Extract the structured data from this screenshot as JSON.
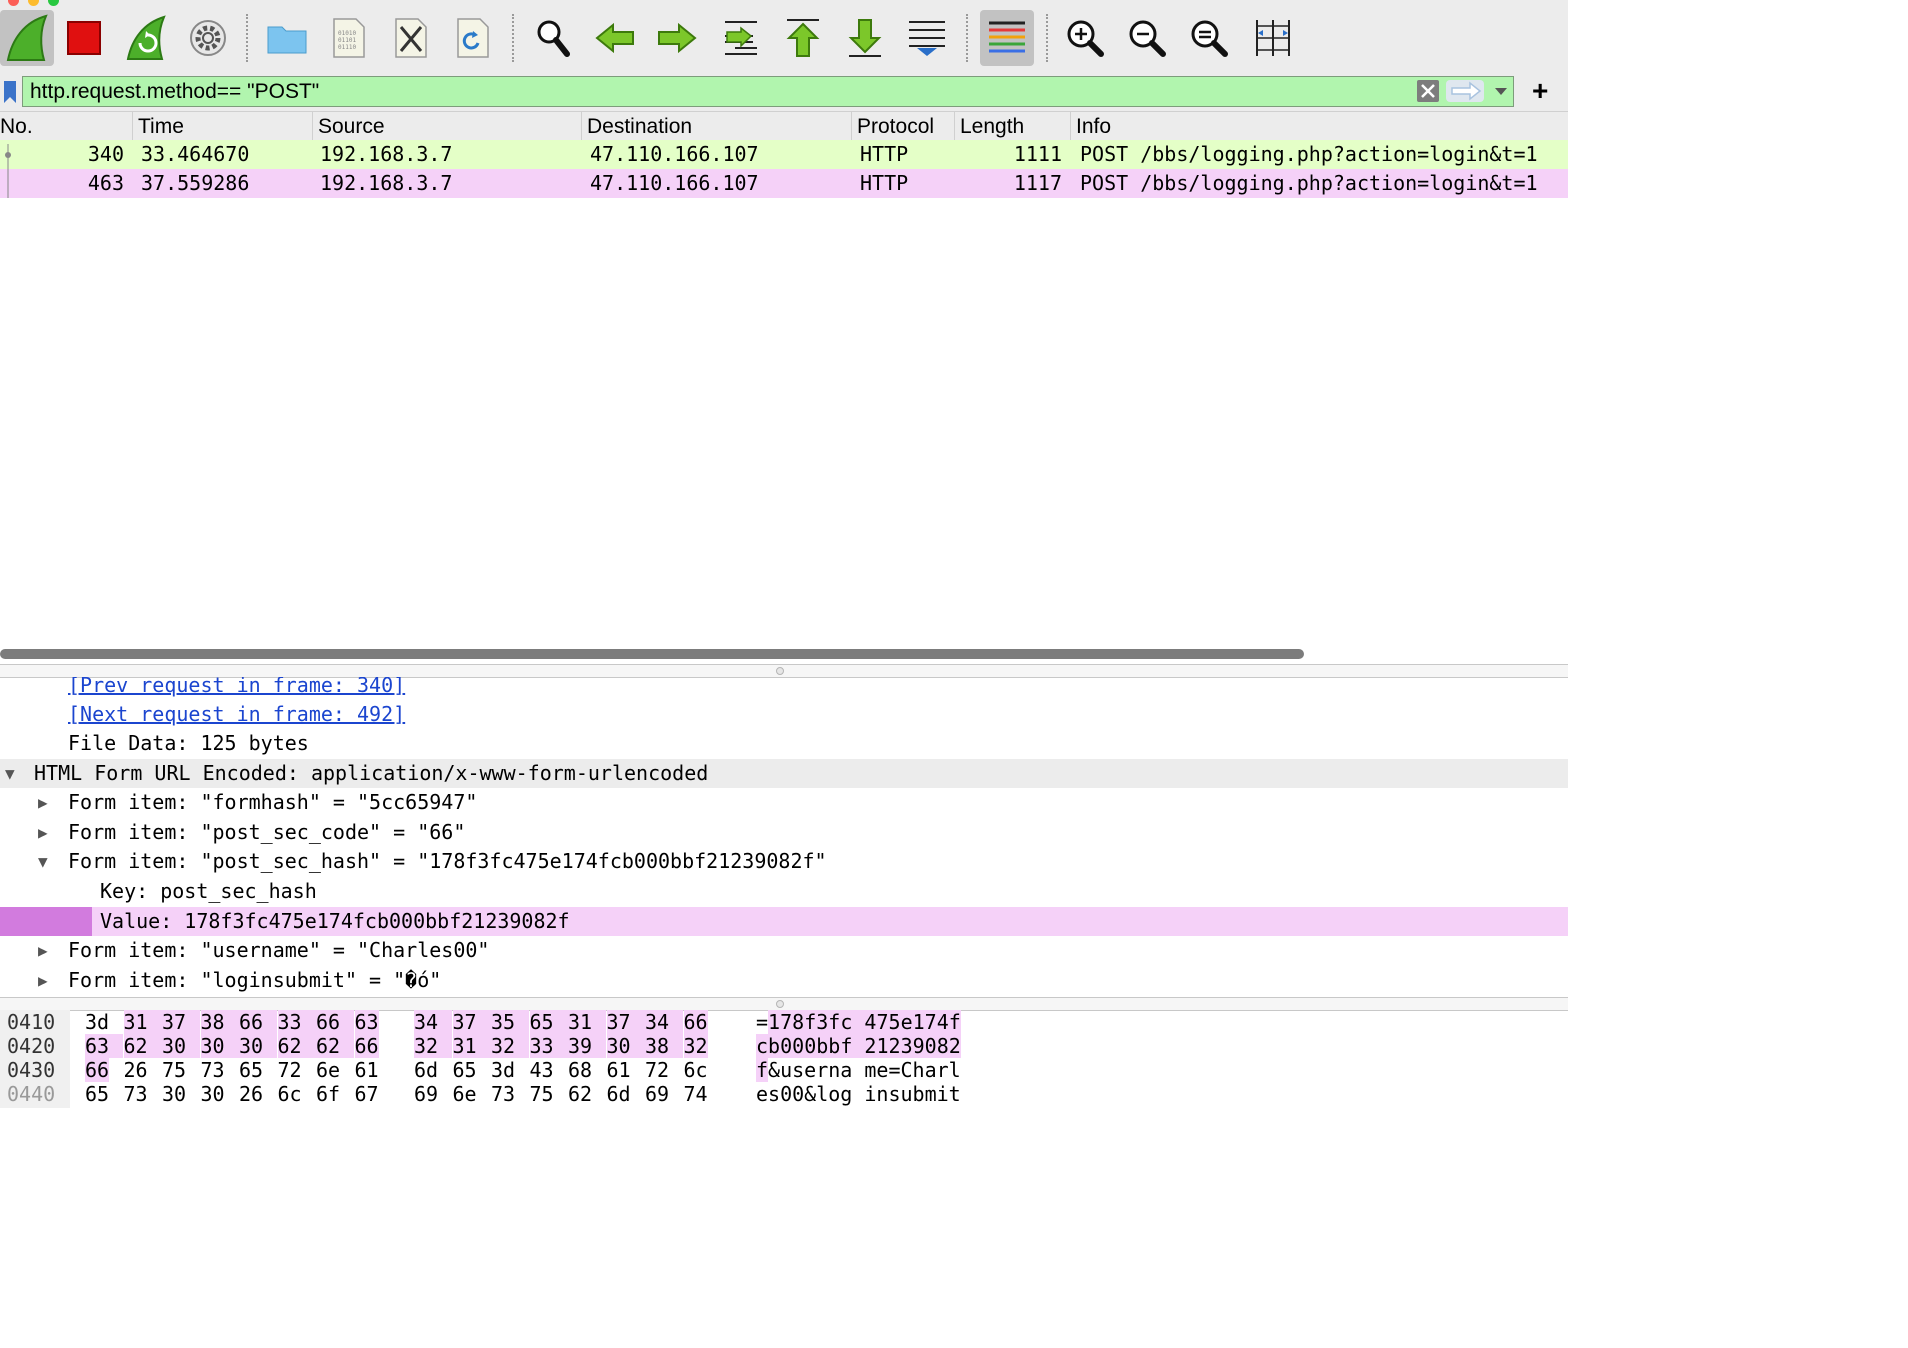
{
  "toolbar": {
    "buttons": [
      {
        "name": "start-capture",
        "icon": "shark-fin-icon"
      },
      {
        "name": "stop-capture",
        "icon": "stop-icon"
      },
      {
        "name": "restart-capture",
        "icon": "restart-fin-icon"
      },
      {
        "name": "capture-options",
        "icon": "gear-icon"
      },
      {
        "name": "open-file",
        "icon": "folder-icon"
      },
      {
        "name": "save-file",
        "icon": "binary-file-icon"
      },
      {
        "name": "close-file",
        "icon": "close-file-icon"
      },
      {
        "name": "reload-file",
        "icon": "reload-file-icon"
      },
      {
        "name": "find-packet",
        "icon": "search-icon"
      },
      {
        "name": "go-back",
        "icon": "arrow-left-icon"
      },
      {
        "name": "go-forward",
        "icon": "arrow-right-icon"
      },
      {
        "name": "go-to-packet",
        "icon": "goto-packet-icon"
      },
      {
        "name": "go-first",
        "icon": "arrow-top-icon"
      },
      {
        "name": "go-last",
        "icon": "arrow-bottom-icon"
      },
      {
        "name": "autoscroll",
        "icon": "autoscroll-icon"
      },
      {
        "name": "colorize",
        "icon": "colorize-icon"
      },
      {
        "name": "zoom-in",
        "icon": "zoom-in-icon"
      },
      {
        "name": "zoom-out",
        "icon": "zoom-out-icon"
      },
      {
        "name": "normal-size",
        "icon": "zoom-reset-icon"
      },
      {
        "name": "resize-columns",
        "icon": "resize-columns-icon"
      }
    ]
  },
  "filter": {
    "value": "http.request.method== \"POST\"",
    "bg_color": "#b1f5ae"
  },
  "packet_list": {
    "columns": [
      "No.",
      "Time",
      "Source",
      "Destination",
      "Protocol",
      "Length",
      "Info"
    ],
    "rows": [
      {
        "no": "340",
        "time": "33.464670",
        "source": "192.168.3.7",
        "destination": "47.110.166.107",
        "protocol": "HTTP",
        "length": "1111",
        "info": "POST /bbs/logging.php?action=login&t=1",
        "color": "#e4ffc7"
      },
      {
        "no": "463",
        "time": "37.559286",
        "source": "192.168.3.7",
        "destination": "47.110.166.107",
        "protocol": "HTTP",
        "length": "1117",
        "info": "POST /bbs/logging.php?action=login&t=1",
        "color": "#f5d1f8"
      }
    ]
  },
  "details": {
    "prev_request": "[Prev request in frame: 340]",
    "next_request": "[Next request in frame: 492]",
    "file_data": "File Data: 125 bytes",
    "form_header": "HTML Form URL Encoded: application/x-www-form-urlencoded",
    "items": [
      "Form item: \"formhash\" = \"5cc65947\"",
      "Form item: \"post_sec_code\" = \"66\"",
      "Form item: \"post_sec_hash\" = \"178f3fc475e174fcb000bbf21239082f\""
    ],
    "key": "Key: post_sec_hash",
    "value": "Value: 178f3fc475e174fcb000bbf21239082f",
    "items_after": [
      "Form item: \"username\" = \"Charles00\"",
      "Form item: \"loginsubmit\" = \"�ó\""
    ]
  },
  "bytes": {
    "rows": [
      {
        "offset": "0410",
        "hex1": [
          "3d",
          "31",
          "37",
          "38",
          "66",
          "33",
          "66",
          "63"
        ],
        "hex2": [
          "34",
          "37",
          "35",
          "65",
          "31",
          "37",
          "34",
          "66"
        ],
        "ascii1": "=178f3fc",
        "ascii2": "475e174f",
        "hl_start": 1
      },
      {
        "offset": "0420",
        "hex1": [
          "63",
          "62",
          "30",
          "30",
          "30",
          "62",
          "62",
          "66"
        ],
        "hex2": [
          "32",
          "31",
          "32",
          "33",
          "39",
          "30",
          "38",
          "32"
        ],
        "ascii1": "cb000bbf",
        "ascii2": "21239082",
        "hl_start": 0
      },
      {
        "offset": "0430",
        "hex1": [
          "66",
          "26",
          "75",
          "73",
          "65",
          "72",
          "6e",
          "61"
        ],
        "hex2": [
          "6d",
          "65",
          "3d",
          "43",
          "68",
          "61",
          "72",
          "6c"
        ],
        "ascii1": "f&userna",
        "ascii2": "me=Charl",
        "hl_end": 1
      },
      {
        "offset": "0440",
        "hex1": [
          "65",
          "73",
          "30",
          "30",
          "26",
          "6c",
          "6f",
          "67"
        ],
        "hex2": [
          "69",
          "6e",
          "73",
          "75",
          "62",
          "6d",
          "69",
          "74"
        ],
        "ascii1": "es00&log",
        "ascii2": "insubmit",
        "hl_end": 0
      }
    ]
  }
}
